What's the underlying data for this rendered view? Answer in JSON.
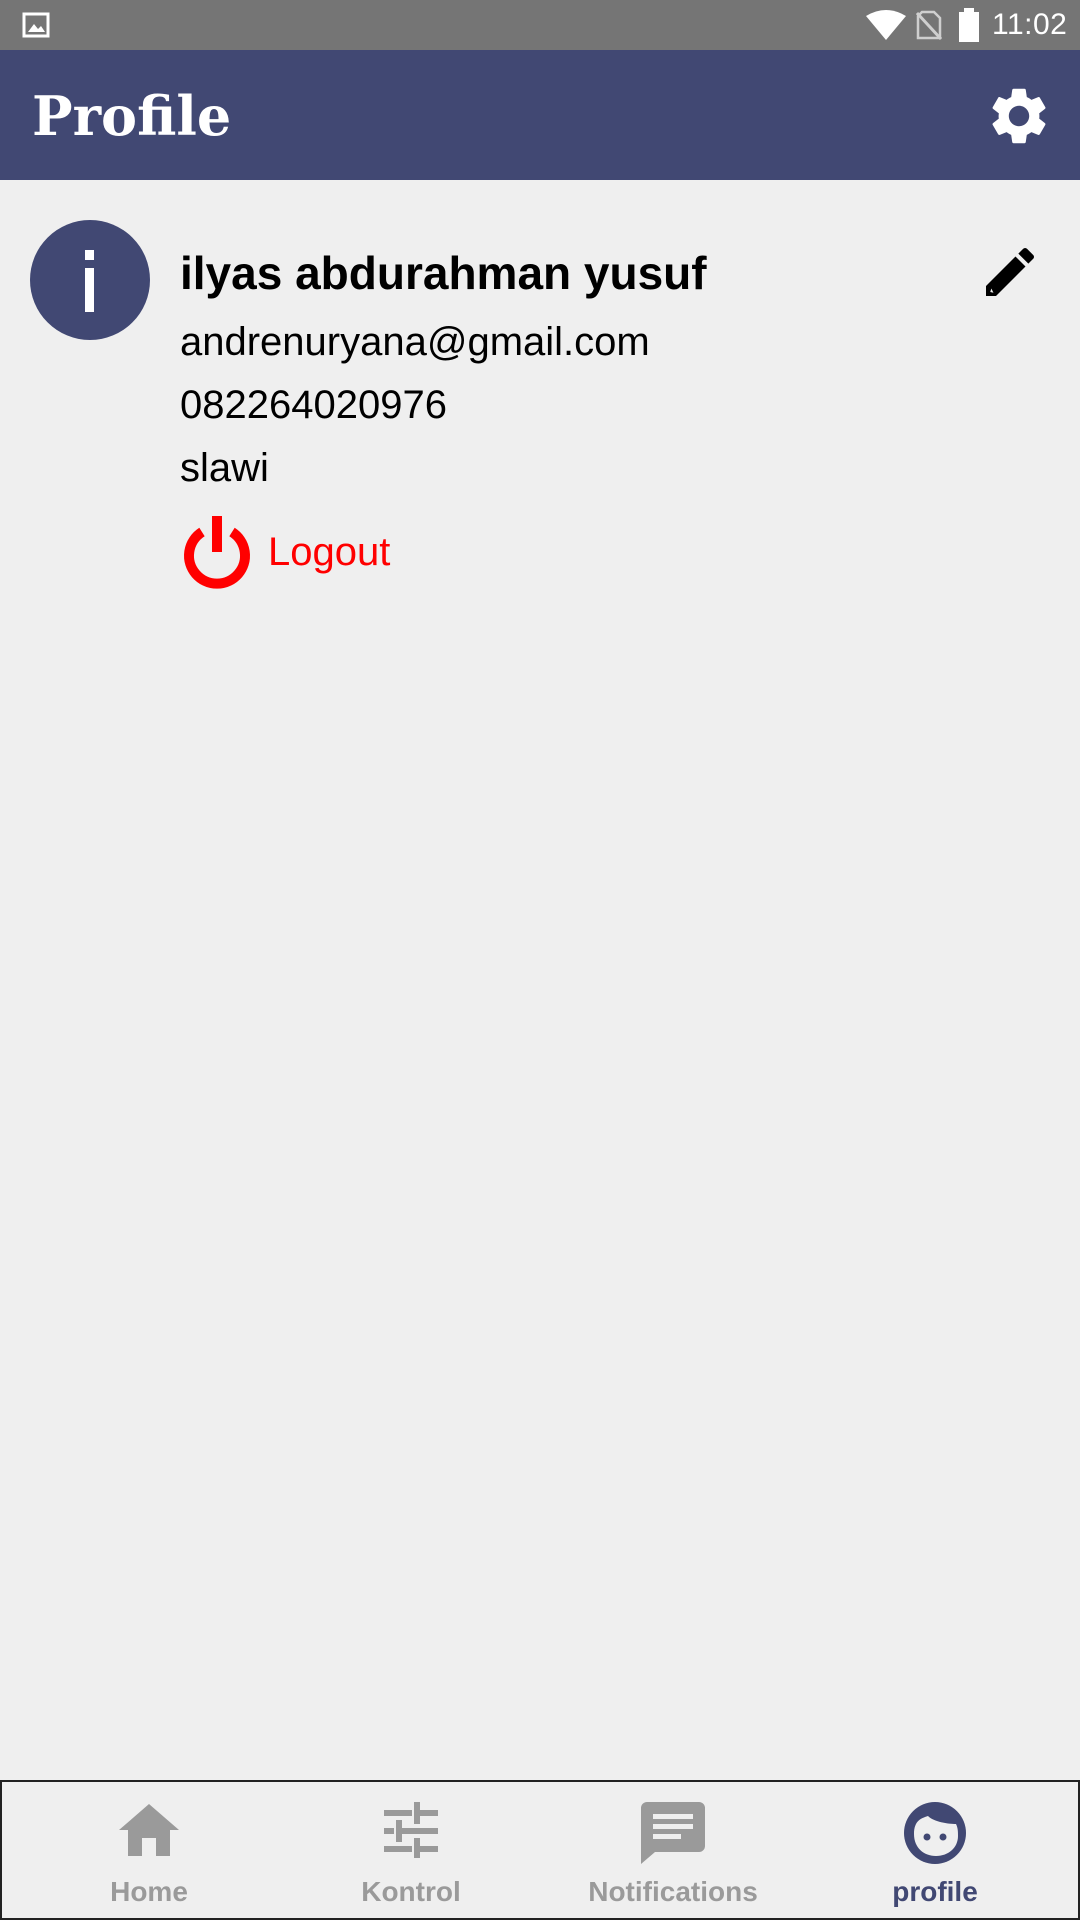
{
  "status_bar": {
    "time": "11:02"
  },
  "app_bar": {
    "title": "Profile"
  },
  "profile": {
    "name": "ilyas abdurahman yusuf",
    "email": "andrenuryana@gmail.com",
    "phone": "082264020976",
    "city": "slawi",
    "logout_label": "Logout",
    "avatar_letter": "i"
  },
  "bottom_nav": {
    "items": [
      {
        "label": "Home",
        "icon": "home-icon",
        "active": false
      },
      {
        "label": "Kontrol",
        "icon": "sliders-icon",
        "active": false
      },
      {
        "label": "Notifications",
        "icon": "message-icon",
        "active": false
      },
      {
        "label": "profile",
        "icon": "face-icon",
        "active": true
      }
    ]
  },
  "colors": {
    "primary": "#414873",
    "logout": "#ff0000",
    "inactive": "#9a9a9a",
    "background": "#efefef"
  }
}
